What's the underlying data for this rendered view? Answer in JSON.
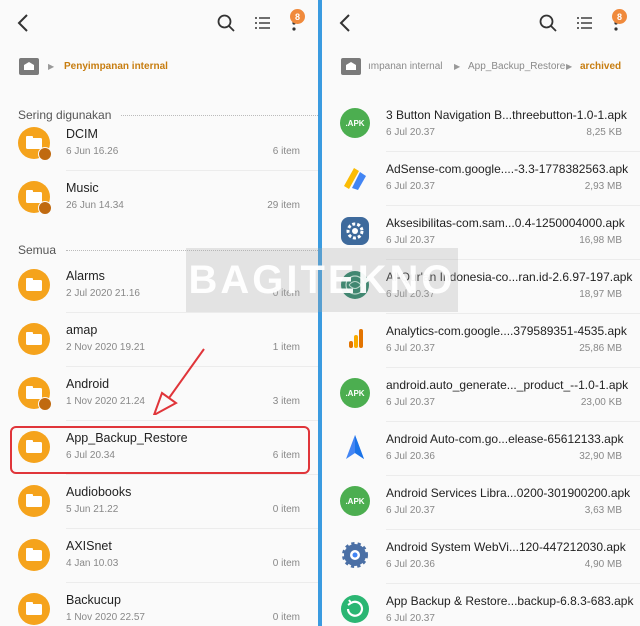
{
  "left": {
    "badge": "8",
    "breadcrumb": "Penyimpanan internal",
    "section_frequent": "Sering digunakan",
    "section_all": "Semua",
    "items": [
      {
        "name": "DCIM",
        "date": "6 Jun 16.26",
        "count": "6 item",
        "sub_icon": "camera-badge-icon"
      },
      {
        "name": "Music",
        "date": "26 Jun 14.34",
        "count": "29 item",
        "sub_icon": "music-badge-icon"
      },
      {
        "name": "Alarms",
        "date": "2 Jul 2020 21.16",
        "count": "0 item"
      },
      {
        "name": "amap",
        "date": "2 Nov 2020 19.21",
        "count": "1 item"
      },
      {
        "name": "Android",
        "date": "1 Nov 2020 21.24",
        "count": "3 item",
        "sub_icon": "gear-badge-icon"
      },
      {
        "name": "App_Backup_Restore",
        "date": "6 Jul 20.34",
        "count": "6 item"
      },
      {
        "name": "Audiobooks",
        "date": "5 Jun 21.22",
        "count": "0 item"
      },
      {
        "name": "AXISnet",
        "date": "4 Jan 10.03",
        "count": "0 item"
      },
      {
        "name": "Backucup",
        "date": "1 Nov 2020 22.57",
        "count": "0 item"
      }
    ]
  },
  "right": {
    "badge": "8",
    "breadcrumb": [
      "ımpanan internal",
      "App_Backup_Restore",
      "archived"
    ],
    "items": [
      {
        "name": "3 Button Navigation B...threebutton-1.0-1.apk",
        "date": "6 Jul 20.37",
        "size": "8,25 KB",
        "icon": "apk-icon"
      },
      {
        "name": "AdSense-com.google....-3.3-1778382563.apk",
        "date": "6 Jul 20.37",
        "size": "2,93 MB",
        "icon": "adsense-icon"
      },
      {
        "name": "Aksesibilitas-com.sam...0.4-1250004000.apk",
        "date": "6 Jul 20.37",
        "size": "16,98 MB",
        "icon": "accessibility-gear-icon"
      },
      {
        "name": "Al-Qur'an Indonesia-co...ran.id-2.6.97-197.apk",
        "date": "6 Jul 20.37",
        "size": "18,97 MB",
        "icon": "quran-icon"
      },
      {
        "name": "Analytics-com.google....379589351-4535.apk",
        "date": "6 Jul 20.37",
        "size": "25,86 MB",
        "icon": "analytics-icon"
      },
      {
        "name": "android.auto_generate..._product_--1.0-1.apk",
        "date": "6 Jul 20.37",
        "size": "23,00 KB",
        "icon": "apk-icon"
      },
      {
        "name": "Android Auto-com.go...elease-65612133.apk",
        "date": "6 Jul 20.36",
        "size": "32,90 MB",
        "icon": "android-auto-icon"
      },
      {
        "name": "Android Services Libra...0200-301900200.apk",
        "date": "6 Jul 20.37",
        "size": "3,63 MB",
        "icon": "apk-icon"
      },
      {
        "name": "Android System WebVi...120-447212030.apk",
        "date": "6 Jul 20.36",
        "size": "4,90 MB",
        "icon": "webview-gear-icon"
      },
      {
        "name": "App Backup & Restore...backup-6.8.3-683.apk",
        "date": "6 Jul 20.37",
        "size": "",
        "icon": "app-backup-icon"
      }
    ]
  },
  "apk_label": ".APK",
  "watermark": "BAGITEKNO",
  "colors": {
    "folder": "#f5a31c",
    "accent": "#c77d10",
    "highlight": "#e0353a",
    "divider": "#3a9be0",
    "apk": "#4cae50"
  }
}
